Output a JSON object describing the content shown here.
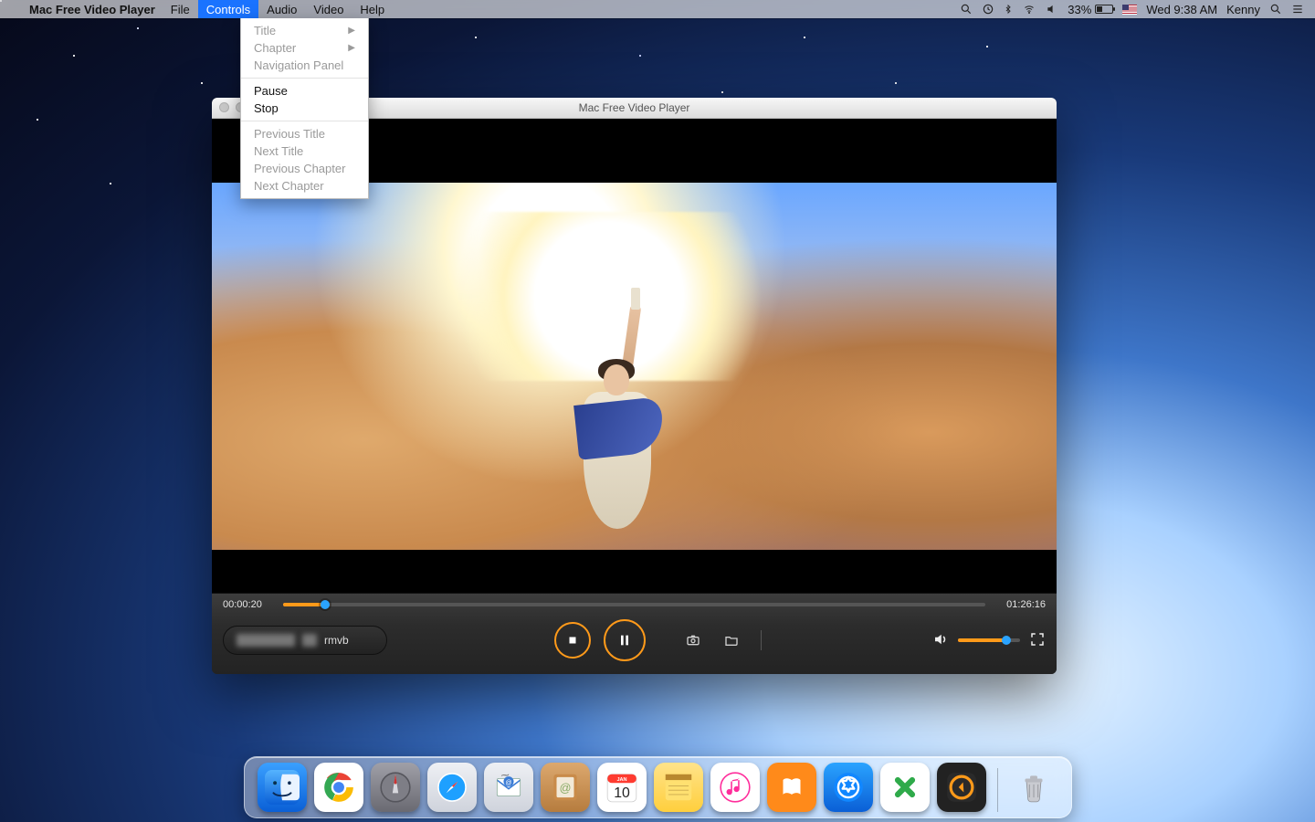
{
  "menubar": {
    "app_name": "Mac Free Video Player",
    "items": [
      "File",
      "Controls",
      "Audio",
      "Video",
      "Help"
    ],
    "active_index": 1,
    "status": {
      "battery_percent": "33%",
      "day_time": "Wed 9:38 AM",
      "user": "Kenny"
    }
  },
  "dropdown": {
    "groups": [
      [
        {
          "label": "Title",
          "has_submenu": true,
          "disabled": true
        },
        {
          "label": "Chapter",
          "has_submenu": true,
          "disabled": true
        },
        {
          "label": "Navigation Panel",
          "has_submenu": false,
          "disabled": true
        }
      ],
      [
        {
          "label": "Pause",
          "has_submenu": false,
          "disabled": false
        },
        {
          "label": "Stop",
          "has_submenu": false,
          "disabled": false
        }
      ],
      [
        {
          "label": "Previous Title",
          "has_submenu": false,
          "disabled": true
        },
        {
          "label": "Next Title",
          "has_submenu": false,
          "disabled": true
        },
        {
          "label": "Previous Chapter",
          "has_submenu": false,
          "disabled": true
        },
        {
          "label": "Next Chapter",
          "has_submenu": false,
          "disabled": true
        }
      ]
    ]
  },
  "player": {
    "window_title": "Mac Free Video Player",
    "time_current": "00:00:20",
    "time_total": "01:26:16",
    "progress_percent": 0.4,
    "file_ext": "rmvb",
    "volume_percent": 78
  },
  "dock": {
    "apps": [
      {
        "name": "finder",
        "bg": "linear-gradient(#3aa0ff,#0a5fd6)"
      },
      {
        "name": "chrome",
        "bg": "#fff"
      },
      {
        "name": "launchpad",
        "bg": "linear-gradient(#8f8f97,#5c5c63)"
      },
      {
        "name": "safari",
        "bg": "linear-gradient(#e9e9ee,#cfcfd8)"
      },
      {
        "name": "mail",
        "bg": "linear-gradient(#e9e9ee,#cfcfd8)"
      },
      {
        "name": "contacts",
        "bg": "linear-gradient(#d9a56b,#b47c3d)"
      },
      {
        "name": "calendar",
        "bg": "#fff"
      },
      {
        "name": "notes",
        "bg": "linear-gradient(#ffe38a,#ffcf3d)"
      },
      {
        "name": "itunes",
        "bg": "#fff"
      },
      {
        "name": "ibooks",
        "bg": "#ff8a1a"
      },
      {
        "name": "appstore",
        "bg": "linear-gradient(#2aa3ff,#0a5fd6)"
      },
      {
        "name": "excel-like",
        "bg": "#fff"
      },
      {
        "name": "video-player",
        "bg": "#222"
      }
    ],
    "calendar": {
      "month_abbr": "JAN",
      "day": "10"
    }
  }
}
